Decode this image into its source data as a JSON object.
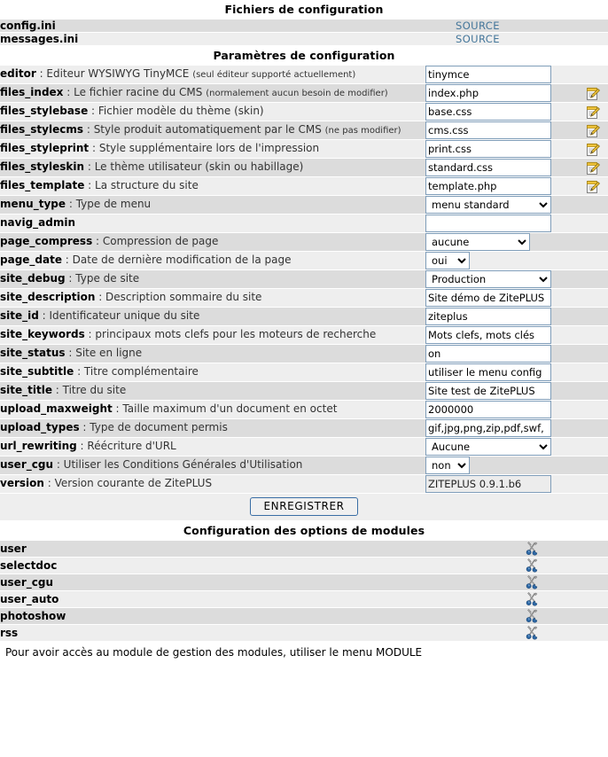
{
  "sections": {
    "files_title": "Fichiers de configuration",
    "params_title": "Paramètres de configuration",
    "modules_title": "Configuration des options de modules"
  },
  "files": [
    {
      "name": "config.ini",
      "source_label": "SOURCE"
    },
    {
      "name": "messages.ini",
      "source_label": "SOURCE"
    }
  ],
  "params": [
    {
      "key": "editor",
      "sep": " : ",
      "desc": "Editeur WYSIWYG TinyMCE ",
      "note": "(seul éditeur supporté actuellement)",
      "control": "text",
      "value": "tinymce",
      "edit": false
    },
    {
      "key": "files_index",
      "sep": " : ",
      "desc": "Le fichier racine du CMS ",
      "note": "(normalement aucun besoin de modifier)",
      "control": "text",
      "value": "index.php",
      "edit": true
    },
    {
      "key": "files_stylebase",
      "sep": " : ",
      "desc": "Fichier modèle du thème (skin)",
      "note": "",
      "control": "text",
      "value": "base.css",
      "edit": true
    },
    {
      "key": "files_stylecms",
      "sep": " : ",
      "desc": "Style produit automatiquement par le CMS ",
      "note": "(ne pas modifier)",
      "control": "text",
      "value": "cms.css",
      "edit": true,
      "justify": true
    },
    {
      "key": "files_styleprint",
      "sep": " : ",
      "desc": "Style supplémentaire lors de l'impression",
      "note": "",
      "control": "text",
      "value": "print.css",
      "edit": true
    },
    {
      "key": "files_styleskin",
      "sep": " : ",
      "desc": "Le thème utilisateur (skin ou habillage)",
      "note": "",
      "control": "text",
      "value": "standard.css",
      "edit": true
    },
    {
      "key": "files_template",
      "sep": " : ",
      "desc": "La structure du site",
      "note": "",
      "control": "text",
      "value": "template.php",
      "edit": true
    },
    {
      "key": "menu_type",
      "sep": " : ",
      "desc": "Type de menu",
      "note": "",
      "control": "select",
      "value": "menu standard",
      "select_width": "wide",
      "edit": false
    },
    {
      "key": "navig_admin",
      "sep": "",
      "desc": "",
      "note": "",
      "control": "text",
      "value": "",
      "edit": false
    },
    {
      "key": "page_compress",
      "sep": " : ",
      "desc": "Compression de page",
      "note": "",
      "control": "select",
      "value": "aucune",
      "select_width": "med",
      "edit": false
    },
    {
      "key": "page_date",
      "sep": " : ",
      "desc": "Date de dernière modification de la page",
      "note": "",
      "control": "select",
      "value": "oui",
      "select_width": "sm",
      "edit": false
    },
    {
      "key": "site_debug",
      "sep": " : ",
      "desc": "Type de site",
      "note": "",
      "control": "select",
      "value": "Production",
      "select_width": "wide",
      "edit": false
    },
    {
      "key": "site_description",
      "sep": " : ",
      "desc": "Description sommaire du site",
      "note": "",
      "control": "text",
      "value": "Site démo de ZitePLUS",
      "edit": false
    },
    {
      "key": "site_id",
      "sep": " : ",
      "desc": "Identificateur unique du site",
      "note": "",
      "control": "text",
      "value": "ziteplus",
      "edit": false
    },
    {
      "key": "site_keywords",
      "sep": " : ",
      "desc": "principaux mots clefs pour les moteurs de recherche",
      "note": "",
      "control": "text",
      "value": "Mots clefs, mots clés",
      "edit": false
    },
    {
      "key": "site_status",
      "sep": " : ",
      "desc": "Site en ligne",
      "note": "",
      "control": "text",
      "value": "on",
      "edit": false
    },
    {
      "key": "site_subtitle",
      "sep": " : ",
      "desc": "Titre complémentaire",
      "note": "",
      "control": "text",
      "value": "utiliser le menu config",
      "edit": false
    },
    {
      "key": "site_title",
      "sep": " : ",
      "desc": "Titre du site",
      "note": "",
      "control": "text",
      "value": "Site test de ZitePLUS",
      "edit": false
    },
    {
      "key": "upload_maxweight",
      "sep": " : ",
      "desc": "Taille maximum d'un document en octet",
      "note": "",
      "control": "text",
      "value": "2000000",
      "edit": false
    },
    {
      "key": "upload_types",
      "sep": " : ",
      "desc": "Type de document permis",
      "note": "",
      "control": "text",
      "value": "gif,jpg,png,zip,pdf,swf,",
      "edit": false
    },
    {
      "key": "url_rewriting",
      "sep": " : ",
      "desc": "Réécriture d'URL",
      "note": "",
      "control": "select",
      "value": "Aucune",
      "select_width": "wide",
      "edit": false
    },
    {
      "key": "user_cgu",
      "sep": " : ",
      "desc": "Utiliser les Conditions Générales d'Utilisation",
      "note": "",
      "control": "select",
      "value": "non",
      "select_width": "sm",
      "edit": false
    },
    {
      "key": "version",
      "sep": " : ",
      "desc": "Version courante de ZitePLUS",
      "note": "",
      "control": "text",
      "value": "ZITEPLUS 0.9.1.b6",
      "readonly": true,
      "edit": false
    }
  ],
  "save_button": "ENREGISTRER",
  "modules": [
    {
      "name": "user"
    },
    {
      "name": "selectdoc"
    },
    {
      "name": "user_cgu"
    },
    {
      "name": "user_auto"
    },
    {
      "name": "photoshow"
    },
    {
      "name": "rss"
    }
  ],
  "footnote": "Pour avoir accès au module de gestion des modules, utiliser le menu MODULE",
  "icons": {
    "edit": "edit-notepad-pencil-icon",
    "tools": "wrench-screwdriver-icon"
  },
  "colors": {
    "link": "#44769a",
    "row_odd": "#dcdcdc",
    "row_even": "#eeeeee",
    "input_border": "#7f9db9",
    "button_border": "#3a6ea5"
  }
}
